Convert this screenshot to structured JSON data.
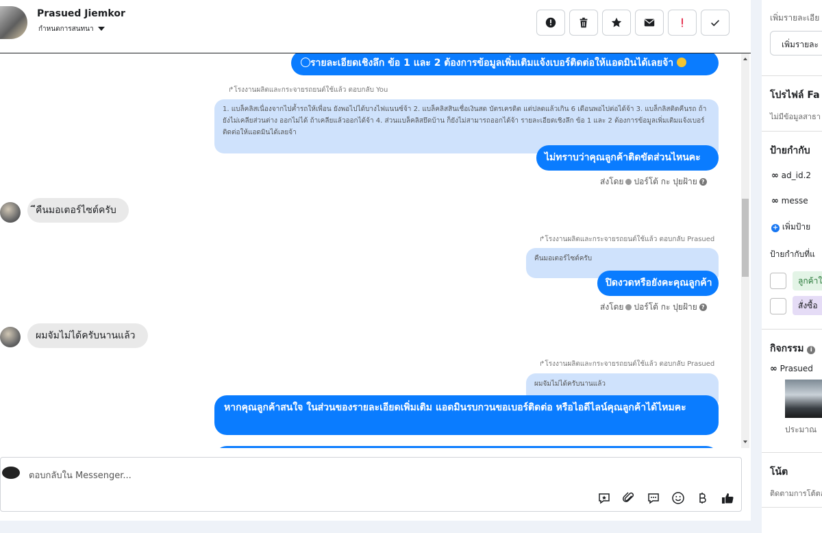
{
  "header": {
    "name": "Prasued Jiemkor",
    "subtitle": "กำหนดการสนทนา"
  },
  "messages": {
    "m1_text": "รายละเอียดเชิงลึก ข้อ 1 และ 2 ต้องการข้อมูลเพิ่มเติมแจ้งเบอร์ติดต่อให้แอดมินได้เลยจ้า",
    "reply1_label": "โรงงานผลิตและกระจายรถยนต์ใช้แล้ว ตอบกลับ You",
    "quote1_text": "1. แบล็คลิสเนื่องจากไปค้ำรถให้เพื่อน ยังพอไปได้บางไฟแนนซ์จ้า 2. แบล็คลิสสินเชื่อเงินสด บัตรเครดิต แต่ปลดแล้วเกิน 6 เดือนพอไปต่อได้จ้า 3. แบล็กลิสติดคืนรถ ถ้ายังไม่เคลียส่วนต่าง ออกไม่ได้ ถ้าเคลียแล้วออกได้จ้า 4. ส่วนแบล็คลิสยึดบ้าน ก็ยังไม่สามารถออกได้จ้า รายละเอียดเชิงลึก ข้อ 1 และ 2 ต้องการข้อมูลเพิ่มเติมแจ้งเบอร์ติดต่อให้แอดมินได้เลยจ้า",
    "m2_text": "ไม่ทราบว่าคุณลูกค้าติดขัดส่วนไหนคะ",
    "sent_by_label": "ส่งโดย",
    "sent_by_name": "ปอร์โต้ กะ ปุยฝ้าย",
    "in1_text": "ีคืนมอเตอร์ไซต์ครับ",
    "reply2_label": "โรงงานผลิตและกระจายรถยนต์ใช้แล้ว ตอบกลับ Prasued",
    "quote2_text": "คืนมอเตอร์ไซต์ครับ",
    "m3_text": "ปิดงวดหรือยังคะคุณลูกค้า",
    "in2_text": "ผมจัมไม่ได้ครับนานแล้ว",
    "reply3_label": "โรงงานผลิตและกระจายรถยนต์ใช้แล้ว ตอบกลับ Prasued",
    "quote3_text": "ผมจัมไม่ได้ครับนานแล้ว",
    "m4_text": "หากคุณลูกค้าสนใจ ในส่วนของรายละเอียดเพิ่มเติม แอดมินรบกวนขอเบอร์ติดต่อ หรือไอดีไลน์คุณลูกค้าได้ไหมคะ"
  },
  "composer": {
    "placeholder": "ตอบกลับใน Messenger..."
  },
  "sidebar": {
    "details_label": "เพิ่มรายละเอีย",
    "details_button": "เพิ่มรายละ",
    "profile_title": "โปรไฟล์ Fa",
    "profile_sub": "ไม่มีข้อมูลสาธา",
    "labels_title": "ป้ายกำกับ",
    "tag1": "ad_id.2",
    "tag2": "messe",
    "add_tag": "เพิ่มป้าย",
    "suggested_title": "ป้ายกำกับที่แ",
    "pill1": "ลูกค้าใ",
    "pill2": "สั่งซื้อ",
    "activity_title": "กิจกรรม",
    "activity_user": "Prasued",
    "activity_time": "ประมาณ",
    "notes_title": "โน้ต",
    "notes_sub": "ติดตามการโต้ตอ"
  },
  "colors": {
    "outgoing": "#0a7cff",
    "quote": "#cfe2fc",
    "incoming": "#e9e9e9",
    "alert_red": "#e41e3f"
  }
}
